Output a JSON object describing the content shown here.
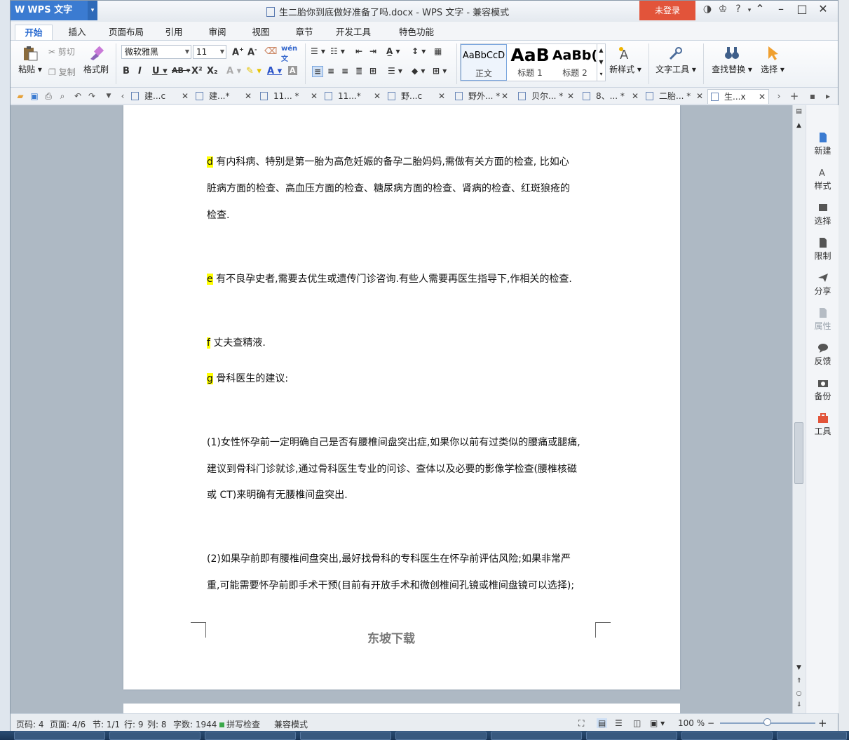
{
  "app": {
    "name": "WPS 文字",
    "document_title": "生二胎你到底做好准备了吗.docx - WPS 文字 - 兼容模式",
    "login_label": "未登录"
  },
  "menu_tabs": [
    "开始",
    "插入",
    "页面布局",
    "引用",
    "审阅",
    "视图",
    "章节",
    "开发工具",
    "特色功能"
  ],
  "ribbon": {
    "paste": "粘贴",
    "cut": "剪切",
    "copy": "复制",
    "format_painter": "格式刷",
    "font_name": "微软雅黑",
    "font_size": "11",
    "styles": [
      {
        "preview": "AaBbCcD",
        "label": "正文"
      },
      {
        "preview": "AaB",
        "label": "标题 1"
      },
      {
        "preview": "AaBb(",
        "label": "标题 2"
      }
    ],
    "new_style": "新样式",
    "text_tools": "文字工具",
    "find_replace": "查找替换",
    "select": "选择"
  },
  "doc_tabs": [
    "建...c",
    "建...*",
    "11... *",
    "11...*",
    "野...c",
    "野外... *",
    "贝尔... *",
    "8、... *",
    "二胎... *",
    "生...x"
  ],
  "document": {
    "paragraphs": [
      {
        "marker": "d",
        "lines": [
          " 有内科病、特别是第一胎为高危妊娠的备孕二胎妈妈,需做有关方面的检查, 比如心",
          "脏病方面的检查、高血压方面的检查、糖尿病方面的检查、肾病的检查、红斑狼疮的",
          "检查."
        ]
      },
      {
        "marker": "e",
        "lines": [
          " 有不良孕史者,需要去优生或遗传门诊咨询.有些人需要再医生指导下,作相关的检查."
        ]
      },
      {
        "marker": "f",
        "lines": [
          " 丈夫查精液."
        ]
      },
      {
        "marker": "g",
        "lines": [
          " 骨科医生的建议:"
        ]
      },
      {
        "marker": "",
        "lines": [
          "(1)女性怀孕前一定明确自己是否有腰椎间盘突出症,如果你以前有过类似的腰痛或腿痛,",
          "建议到骨科门诊就诊,通过骨科医生专业的问诊、查体以及必要的影像学检查(腰椎核磁",
          "或 CT)来明确有无腰椎间盘突出."
        ]
      },
      {
        "marker": "",
        "lines": [
          "(2)如果孕前即有腰椎间盘突出,最好找骨科的专科医生在怀孕前评估风险;如果非常严",
          "重,可能需要怀孕前即手术干预(目前有开放手术和微创椎间孔镜或椎间盘镜可以选择);"
        ]
      }
    ],
    "footer": "东坡下载"
  },
  "right_panel": [
    "新建",
    "样式",
    "选择",
    "限制",
    "分享",
    "属性",
    "反馈",
    "备份",
    "工具"
  ],
  "status": {
    "page_num": "页码: 4",
    "pages": "页面: 4/6",
    "section": "节: 1/1",
    "line": "行: 9",
    "col": "列: 8",
    "word_count": "字数: 1944",
    "spell_check": "拼写检查",
    "compat_mode": "兼容模式",
    "zoom": "100 %"
  },
  "colors": {
    "accent": "#3b7bd1",
    "login": "#e2543a",
    "highlight": "#ffff00"
  }
}
